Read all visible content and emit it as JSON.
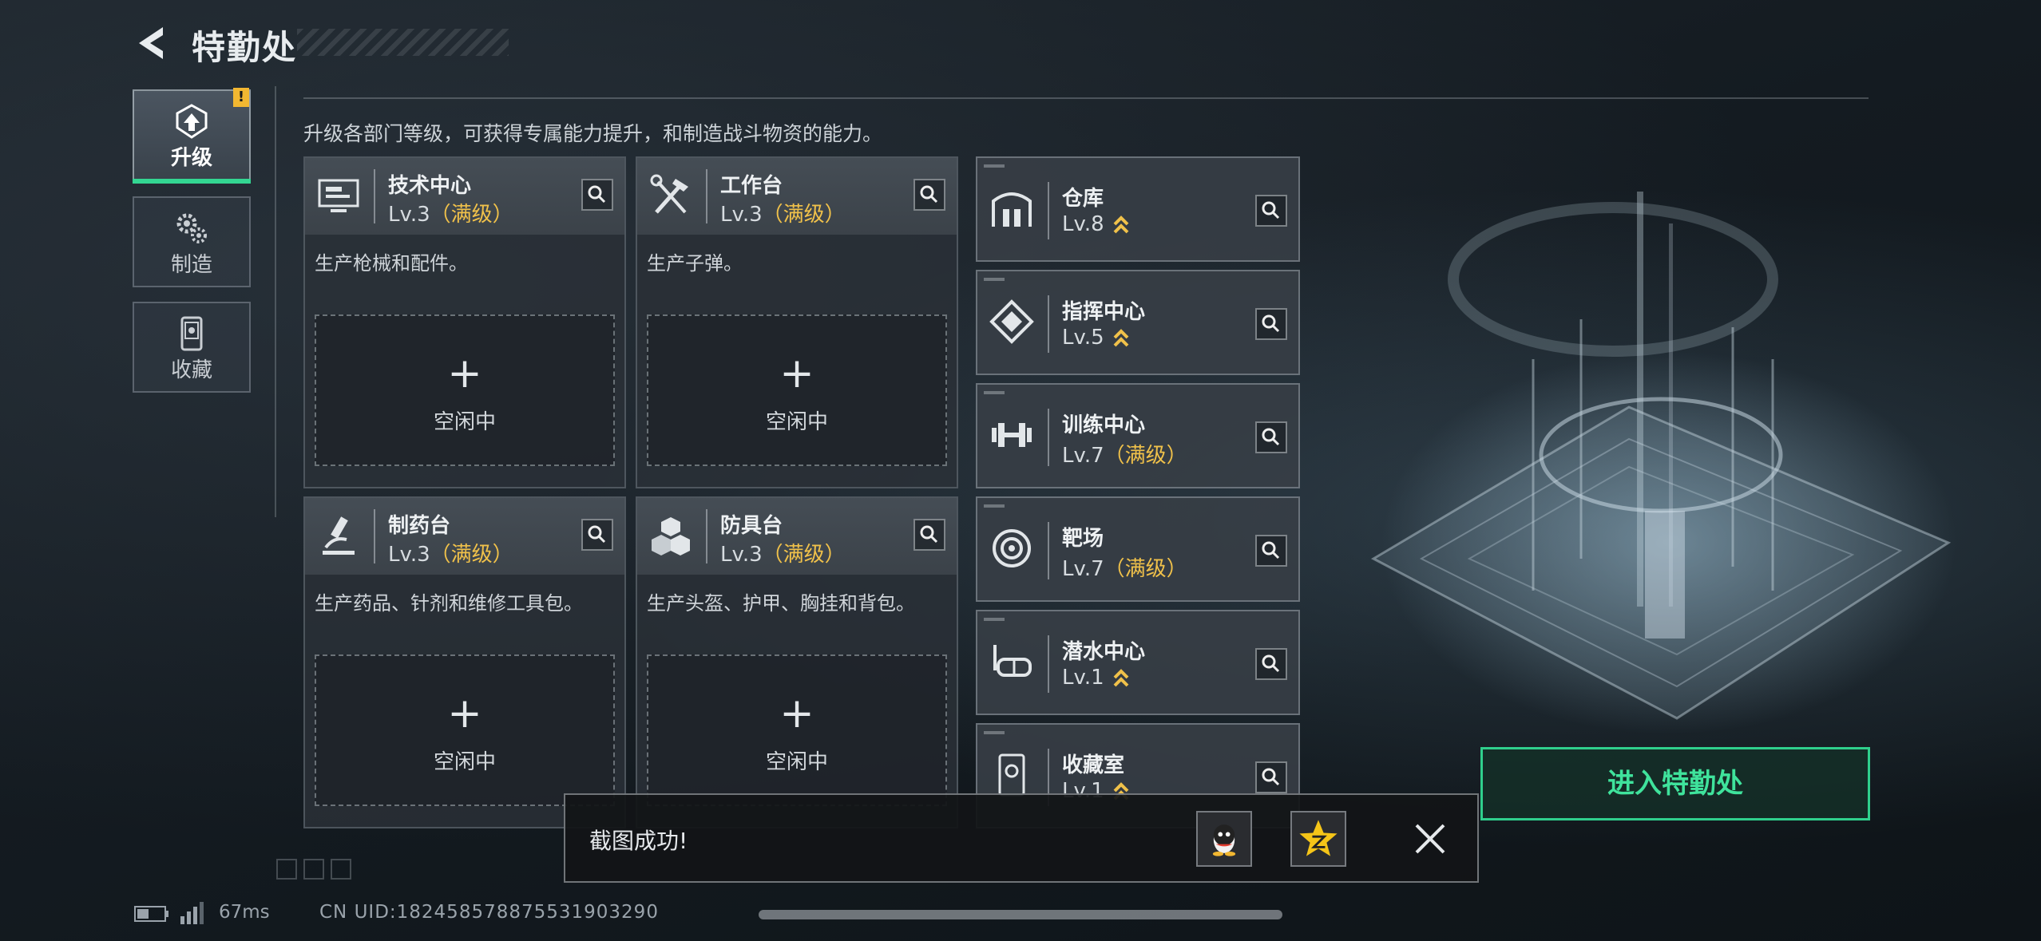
{
  "header": {
    "title": "特勤处"
  },
  "sidebar": {
    "tabs": [
      {
        "label": "升级",
        "icon": "upgrade-icon",
        "active": true,
        "alert": "!"
      },
      {
        "label": "制造",
        "icon": "gears-icon",
        "active": false
      },
      {
        "label": "收藏",
        "icon": "collection-icon",
        "active": false
      }
    ]
  },
  "description": "升级各部门等级，可获得专属能力提升，和制造战斗物资的能力。",
  "departments": [
    {
      "name": "技术中心",
      "level": "Lv.3",
      "status": "（满级）",
      "desc": "生产枪械和配件。",
      "slot_label": "空闲中",
      "icon": "tech-monitor-icon"
    },
    {
      "name": "工作台",
      "level": "Lv.3",
      "status": "（满级）",
      "desc": "生产子弹。",
      "slot_label": "空闲中",
      "icon": "tools-icon"
    },
    {
      "name": "制药台",
      "level": "Lv.3",
      "status": "（满级）",
      "desc": "生产药品、针剂和维修工具包。",
      "slot_label": "空闲中",
      "icon": "microscope-icon"
    },
    {
      "name": "防具台",
      "level": "Lv.3",
      "status": "（满级）",
      "desc": "生产头盔、护甲、胸挂和背包。",
      "slot_label": "空闲中",
      "icon": "armor-blocks-icon"
    }
  ],
  "facilities": [
    {
      "name": "仓库",
      "level": "Lv.8",
      "status": "",
      "upgradable": true,
      "icon": "warehouse-icon"
    },
    {
      "name": "指挥中心",
      "level": "Lv.5",
      "status": "",
      "upgradable": true,
      "icon": "command-icon"
    },
    {
      "name": "训练中心",
      "level": "Lv.7",
      "status": "（满级）",
      "upgradable": false,
      "icon": "dumbbell-icon"
    },
    {
      "name": "靶场",
      "level": "Lv.7",
      "status": "（满级）",
      "upgradable": false,
      "icon": "target-icon"
    },
    {
      "name": "潜水中心",
      "level": "Lv.1",
      "status": "",
      "upgradable": true,
      "icon": "diving-mask-icon"
    },
    {
      "name": "收藏室",
      "level": "Lv.1",
      "status": "",
      "upgradable": true,
      "icon": "trophy-case-icon"
    }
  ],
  "enter_button": {
    "label": "进入特勤处"
  },
  "toast": {
    "message": "截图成功!",
    "share_targets": [
      "qq-icon",
      "qzone-icon"
    ]
  },
  "footer": {
    "ping": "67ms",
    "uid": "CN UID:182458578875531903290"
  },
  "colors": {
    "accent_green": "#33d692",
    "maxed_gold": "#f0c14a",
    "alert_yellow": "#f2b731"
  }
}
